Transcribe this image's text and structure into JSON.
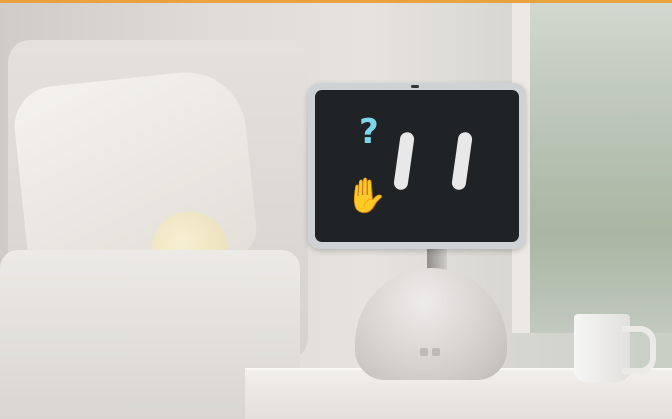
{
  "scene": {
    "description_icons": {
      "question_mark": "?",
      "hand": "✋"
    },
    "colors": {
      "accent_topbar": "#e8a33c",
      "screen": "#202326",
      "question_mark": "#7ed6ea"
    }
  }
}
